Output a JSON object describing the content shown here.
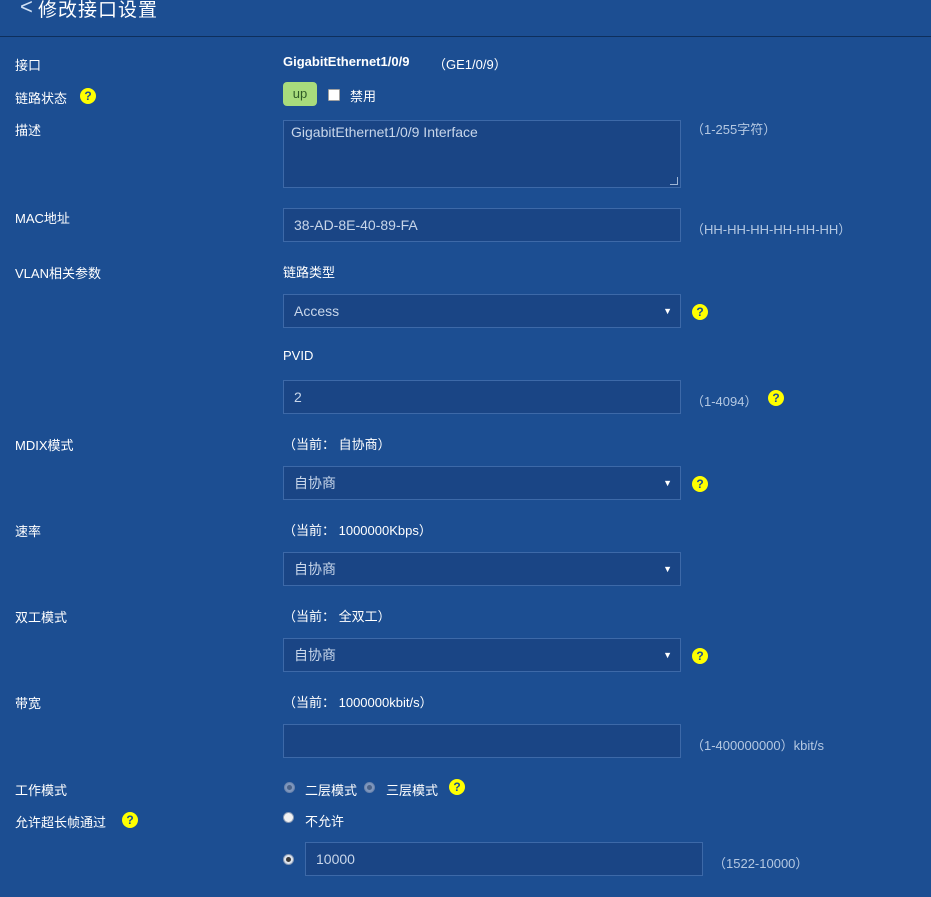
{
  "header": {
    "title": "修改接口设置",
    "back_icon": "<"
  },
  "interface": {
    "label": "接口",
    "name": "GigabitEthernet1/0/9",
    "short": "（GE1/0/9）"
  },
  "link_state": {
    "label": "链路状态",
    "status": "up",
    "disable_label": "禁用"
  },
  "description": {
    "label": "描述",
    "value": "GigabitEthernet1/0/9 Interface",
    "hint": "（1-255字符）"
  },
  "mac": {
    "label": "MAC地址",
    "value": "38-AD-8E-40-89-FA",
    "hint": "（HH-HH-HH-HH-HH-HH）"
  },
  "vlan": {
    "label": "VLAN相关参数",
    "link_type_label": "链路类型",
    "link_type_value": "Access",
    "pvid_label": "PVID",
    "pvid_value": "2",
    "pvid_hint": "（1-4094）"
  },
  "mdix": {
    "label": "MDIX模式",
    "current": "（当前： 自协商）",
    "value": "自协商"
  },
  "speed": {
    "label": "速率",
    "current": "（当前： 1000000Kbps）",
    "value": "自协商"
  },
  "duplex": {
    "label": "双工模式",
    "current": "（当前： 全双工）",
    "value": "自协商"
  },
  "bandwidth": {
    "label": "带宽",
    "current": "（当前： 1000000kbit/s）",
    "value": "",
    "hint": "（1-400000000）kbit/s"
  },
  "work_mode": {
    "label": "工作模式",
    "option_l2": "二层模式",
    "option_l3": "三层模式"
  },
  "jumbo": {
    "label": "允许超长帧通过",
    "option_deny": "不允许",
    "value": "10000",
    "hint": "（1522-10000）"
  },
  "help_glyph": "?",
  "select_arrow": "▼",
  "colors": {
    "background": "#1c4e92",
    "field": "#1a4585",
    "help": "#ffff00",
    "status_up": "#a8dc7c"
  }
}
